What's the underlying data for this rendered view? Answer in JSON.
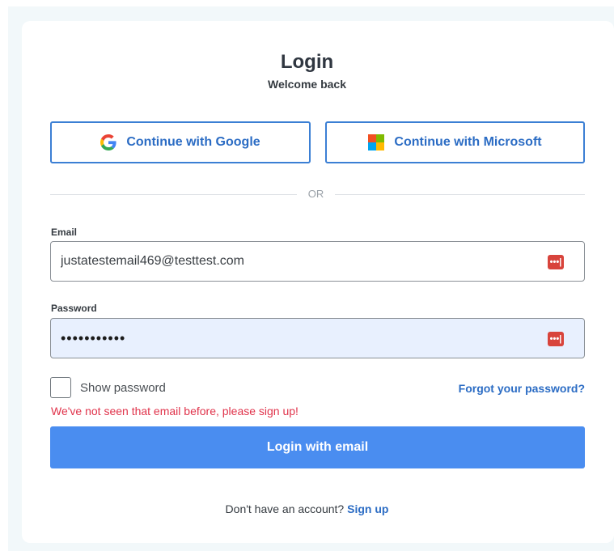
{
  "header": {
    "title": "Login",
    "subtitle": "Welcome back"
  },
  "sso": {
    "google_label": "Continue with Google",
    "microsoft_label": "Continue with Microsoft",
    "google_icon": "google-icon",
    "microsoft_icon": "microsoft-icon"
  },
  "divider_text": "OR",
  "email": {
    "label": "Email",
    "value": "justatestemail469@testtest.com"
  },
  "password": {
    "label": "Password",
    "value": "•••••••••••"
  },
  "password_manager_icon_text": "•••|",
  "show_password_label": "Show password",
  "forgot_password_label": "Forgot your password?",
  "error_message": "We've not seen that email before, please sign up!",
  "login_button_label": "Login with email",
  "signup": {
    "prompt": "Don't have an account?",
    "link": "Sign up"
  },
  "colors": {
    "accent": "#4a8df0",
    "link": "#2b6cc4",
    "error": "#e0334b",
    "autofill_bg": "#e8f0fe",
    "backdrop": "#f2f8fa"
  }
}
